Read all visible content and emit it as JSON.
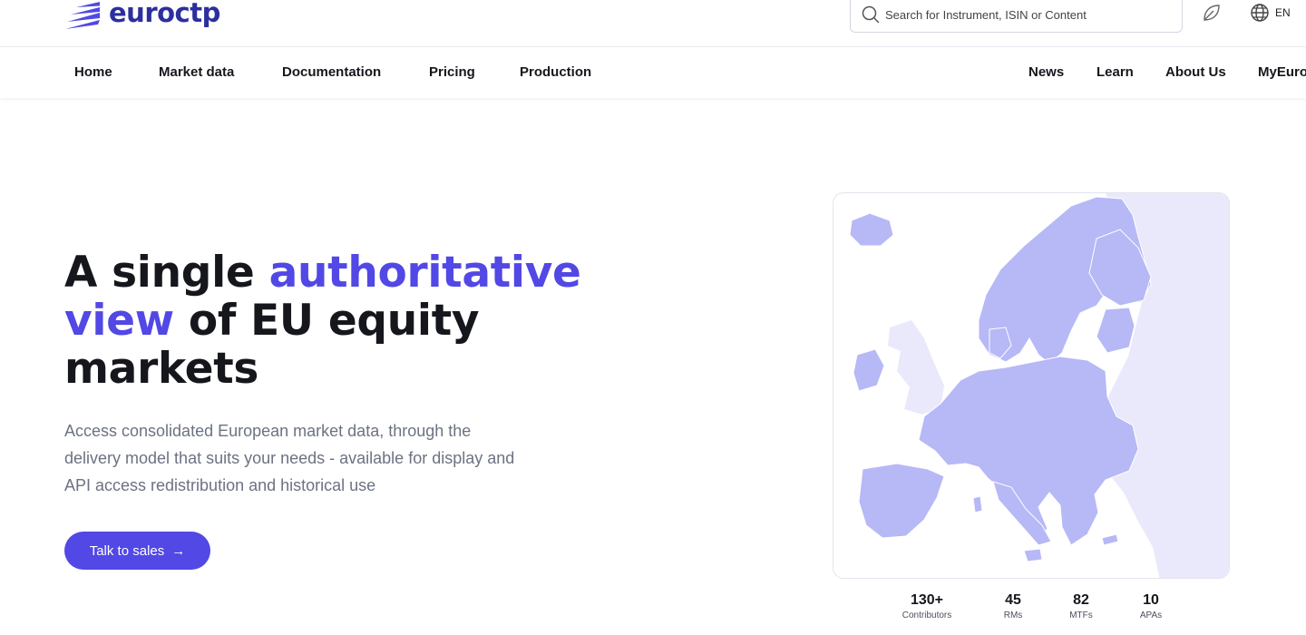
{
  "brand": {
    "name": "euroctp"
  },
  "search": {
    "placeholder": "Search for Instrument, ISIN or Content"
  },
  "language": {
    "label": "EN"
  },
  "nav": {
    "left": [
      "Home",
      "Market data",
      "Documentation",
      "Pricing",
      "Production"
    ],
    "right": [
      "News",
      "Learn",
      "About Us",
      "MyEuro"
    ]
  },
  "hero": {
    "title_part1": "A single ",
    "title_accent1": "authoritative view",
    "title_part2": " of EU equity markets",
    "subtitle": "Access consolidated European market data, through the delivery model that suits your needs - available for display and API access redistribution and historical use",
    "cta_label": "Talk to sales",
    "cta_arrow": "→"
  },
  "stats": [
    {
      "value": "130+",
      "label": "Contributors"
    },
    {
      "value": "45",
      "label": "RMs"
    },
    {
      "value": "82",
      "label": "MTFs"
    },
    {
      "value": "10",
      "label": "APAs"
    }
  ],
  "colors": {
    "accent": "#5148e5",
    "brand": "#2c2f9e",
    "map_member": "#b7b8f6",
    "map_other": "#e9e9fb"
  },
  "icons": {
    "search": "search-icon",
    "leaf": "leaf-icon",
    "globe": "globe-icon",
    "arrow": "arrow-right-icon"
  }
}
